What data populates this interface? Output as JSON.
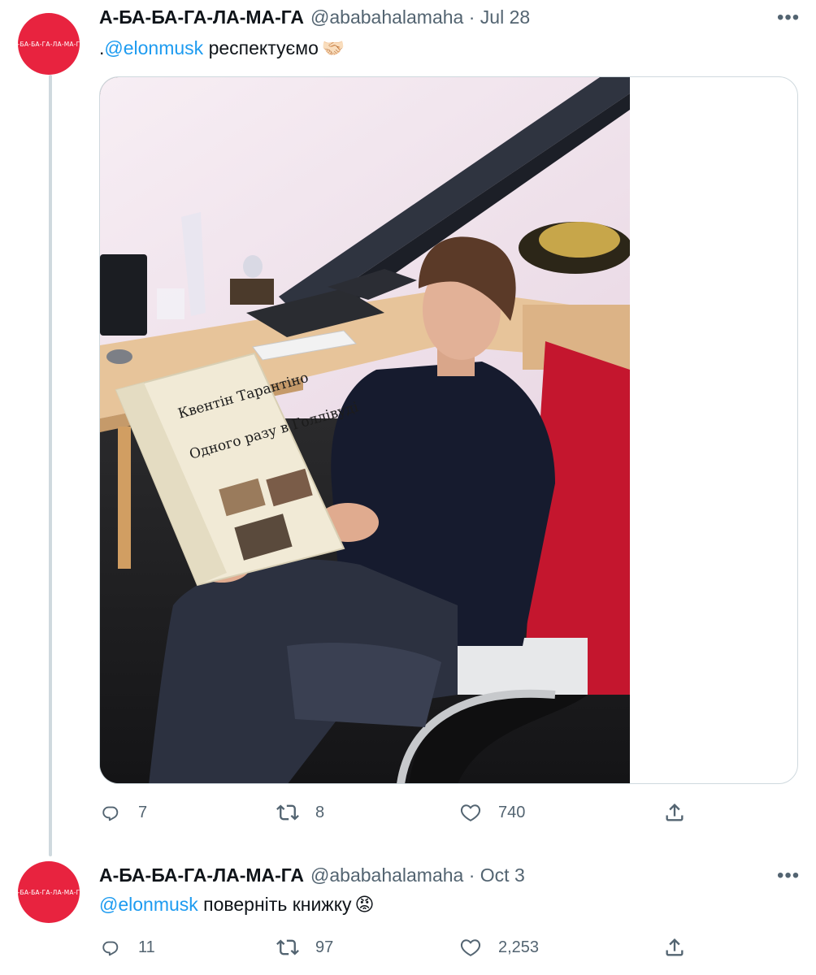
{
  "tweets": [
    {
      "avatar_text": "А-БА-БА-ГА-ЛА-МА-ГА",
      "display_name": "А-БА-БА-ГА-ЛА-МА-ГА",
      "handle_date": "@ababahalamaha · Jul 28",
      "text_prefix": ".",
      "mention": "@elonmusk",
      "text_rest": " респектуємо",
      "emoji": "🤝🏻",
      "book": {
        "author": "Квентін Тарантіно",
        "title": "Одного разу в Голлівуді"
      },
      "stats": {
        "replies": "7",
        "retweets": "8",
        "likes": "740"
      }
    },
    {
      "avatar_text": "А-БА-БА-ГА-ЛА-МА-ГА",
      "display_name": "А-БА-БА-ГА-ЛА-МА-ГА",
      "handle_date": "@ababahalamaha · Oct 3",
      "mention": "@elonmusk",
      "text_rest": " поверніть книжку",
      "emoji": "😡",
      "stats": {
        "replies": "11",
        "retweets": "97",
        "likes": "2,253"
      }
    }
  ],
  "icons": {
    "reply": "reply-icon",
    "retweet": "retweet-icon",
    "like": "heart-icon",
    "share": "share-icon",
    "more": "more-icon"
  },
  "colors": {
    "accent": "#1d9bf0",
    "avatar": "#e8233f",
    "muted": "#536471"
  }
}
